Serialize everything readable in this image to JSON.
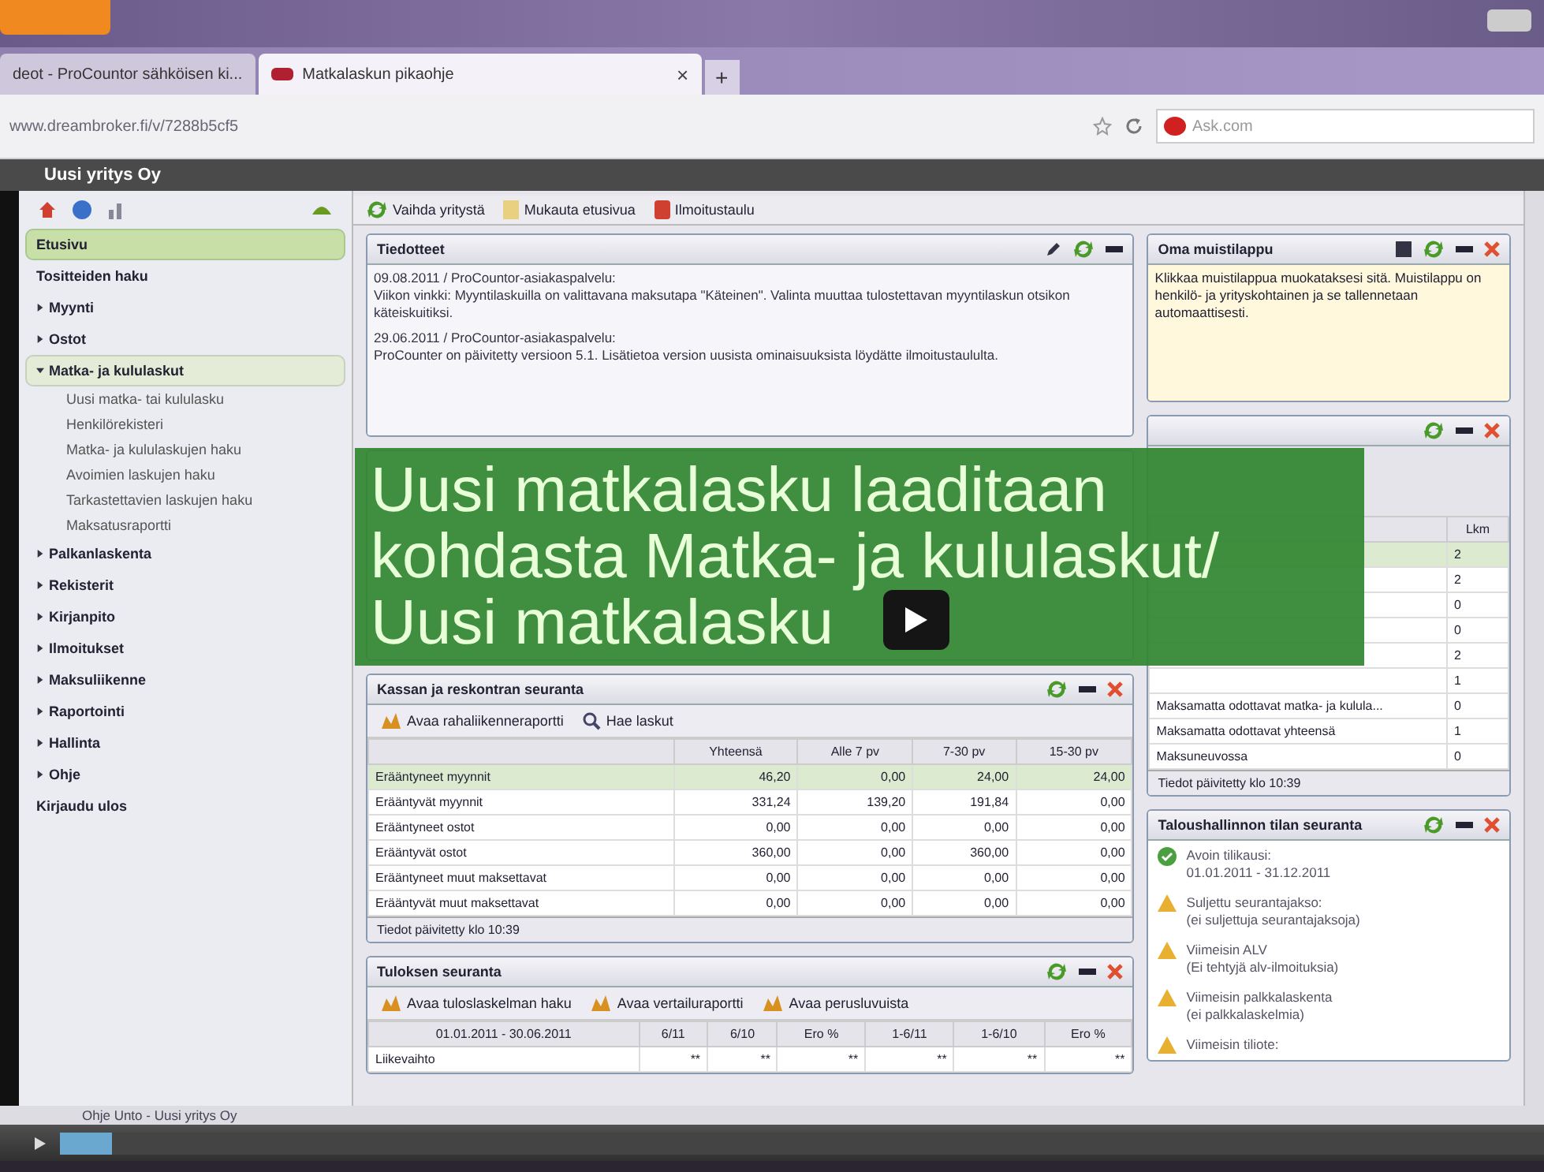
{
  "browser": {
    "tabs": [
      {
        "label": "deot - ProCountor sähköisen ki...",
        "selected": false
      },
      {
        "label": "Matkalaskun pikaohje",
        "selected": true
      }
    ],
    "tab_close": "×",
    "new_tab": "+",
    "address": "www.dreambroker.fi/v/7288b5cf5",
    "search_engine": "Ask.com"
  },
  "app": {
    "title": "Uusi yritys Oy",
    "sidebar": {
      "items": [
        {
          "label": "Etusivu",
          "kind": "link",
          "selected": true
        },
        {
          "label": "Tositteiden haku",
          "kind": "link",
          "selected": false
        },
        {
          "label": "Myynti",
          "kind": "folder",
          "expanded": false,
          "selected": false
        },
        {
          "label": "Ostot",
          "kind": "folder",
          "expanded": false,
          "selected": false
        },
        {
          "label": "Matka- ja kululaskut",
          "kind": "folder",
          "expanded": true,
          "selected": false,
          "children": [
            {
              "label": "Uusi matka- tai kululasku"
            },
            {
              "label": "Henkilörekisteri"
            },
            {
              "label": "Matka- ja kululaskujen haku"
            },
            {
              "label": "Avoimien laskujen haku"
            },
            {
              "label": "Tarkastettavien laskujen haku"
            },
            {
              "label": "Maksatusraportti"
            }
          ]
        },
        {
          "label": "Palkanlaskenta",
          "kind": "folder",
          "expanded": false,
          "selected": false
        },
        {
          "label": "Rekisterit",
          "kind": "folder",
          "expanded": false,
          "selected": false
        },
        {
          "label": "Kirjanpito",
          "kind": "folder",
          "expanded": false,
          "selected": false
        },
        {
          "label": "Ilmoitukset",
          "kind": "folder",
          "expanded": false,
          "selected": false
        },
        {
          "label": "Maksuliikenne",
          "kind": "folder",
          "expanded": false,
          "selected": false
        },
        {
          "label": "Raportointi",
          "kind": "folder",
          "expanded": false,
          "selected": false
        },
        {
          "label": "Hallinta",
          "kind": "folder",
          "expanded": false,
          "selected": false
        },
        {
          "label": "Ohje",
          "kind": "folder",
          "expanded": false,
          "selected": false
        },
        {
          "label": "Kirjaudu ulos",
          "kind": "link",
          "selected": false
        }
      ]
    },
    "toolbar": [
      "Vaihda yritystä",
      "Mukauta etusivua",
      "Ilmoitustaulu"
    ],
    "news": {
      "title": "Tiedotteet",
      "entries": [
        {
          "header": "09.08.2011 / ProCountor-asiakaspalvelu:",
          "text": "Viikon vinkki: Myyntilaskuilla on valittavana maksutapa \"Käteinen\". Valinta muuttaa tulostettavan myyntilaskun otsikon käteiskuitiksi."
        },
        {
          "header": "29.06.2011 / ProCountor-asiakaspalvelu:",
          "text": "ProCounter on päivitetty versioon 5.1. Lisätietoa version uusista ominaisuuksista löydätte ilmoitustaululta."
        }
      ]
    },
    "cash": {
      "title": "Kassan ja reskontran seuranta",
      "buttons": [
        "Avaa rahaliikenneraportti",
        "Hae laskut"
      ],
      "columns": [
        "Yhteensä",
        "Alle 7 pv",
        "7-30 pv",
        "15-30 pv"
      ],
      "rows": [
        {
          "label": "Erääntyneet myynnit",
          "values": [
            "46,20",
            "0,00",
            "24,00",
            "24,00"
          ],
          "selected": true
        },
        {
          "label": "Erääntyvät myynnit",
          "values": [
            "331,24",
            "139,20",
            "191,84",
            "0,00"
          ],
          "selected": false
        },
        {
          "label": "Erääntyneet ostot",
          "values": [
            "0,00",
            "0,00",
            "0,00",
            "0,00"
          ],
          "selected": false
        },
        {
          "label": "Erääntyvät ostot",
          "values": [
            "360,00",
            "0,00",
            "360,00",
            "0,00"
          ],
          "selected": false
        },
        {
          "label": "Erääntyneet muut maksettavat",
          "values": [
            "0,00",
            "0,00",
            "0,00",
            "0,00"
          ],
          "selected": false
        },
        {
          "label": "Erääntyvät muut maksettavat",
          "values": [
            "0,00",
            "0,00",
            "0,00",
            "0,00"
          ],
          "selected": false
        }
      ],
      "footer": "Tiedot päivitetty klo 10:39"
    },
    "result": {
      "title": "Tuloksen seuranta",
      "buttons": [
        "Avaa tuloslaskelman haku",
        "Avaa vertailuraportti",
        "Avaa perusluvuista"
      ],
      "columns": [
        "01.01.2011 - 30.06.2011",
        "6/11",
        "6/10",
        "Ero %",
        "1-6/11",
        "1-6/10",
        "Ero %"
      ],
      "rows": [
        {
          "label": "Liikevaihto",
          "values": [
            "**",
            "**",
            "**",
            "**",
            "**",
            "**"
          ]
        }
      ]
    },
    "note": {
      "title": "Oma muistilappu",
      "text": "Klikkaa muistilappua muokataksesi sitä. Muistilappu on henkilö- ja yrityskohtainen ja se tallennetaan automaattisesti."
    },
    "stats": {
      "columns": [
        "Lkm"
      ],
      "rows": [
        {
          "count": "2",
          "selected": true
        },
        {
          "count": "2",
          "selected": false
        },
        {
          "count": "0",
          "selected": false
        },
        {
          "count": "0",
          "selected": false
        },
        {
          "count": "2",
          "selected": false
        },
        {
          "count": "1",
          "selected": false
        },
        {
          "label": "Maksamatta odottavat matka- ja kulula...",
          "count": "0",
          "selected": false
        },
        {
          "label": "Maksamatta odottavat yhteensä",
          "count": "1",
          "selected": false
        },
        {
          "label": "Maksuneuvossa",
          "count": "0",
          "selected": false
        }
      ],
      "footer": "Tiedot päivitetty klo 10:39"
    },
    "status": {
      "title": "Taloushallinnon tilan seuranta",
      "items": [
        {
          "kind": "ok",
          "title": "Avoin tilikausi:",
          "detail": "01.01.2011 - 31.12.2011"
        },
        {
          "kind": "warning",
          "title": "Suljettu seurantajakso:",
          "detail": "(ei suljettuja seurantajaksoja)"
        },
        {
          "kind": "warning",
          "title": "Viimeisin ALV",
          "detail": "(Ei tehtyjä alv-ilmoituksia)"
        },
        {
          "kind": "warning",
          "title": "Viimeisin palkkalaskenta",
          "detail": "(ei palkkalaskelmia)"
        },
        {
          "kind": "warning",
          "title": "Viimeisin tiliote:"
        }
      ]
    },
    "status_bar": "Ohje  Unto - Uusi yritys Oy"
  },
  "caption": "Uusi matkalasku laaditaan kohdasta Matka- ja kululaskut/ Uusi matkalasku",
  "player": {
    "progress": {
      "level": 0.035
    }
  }
}
